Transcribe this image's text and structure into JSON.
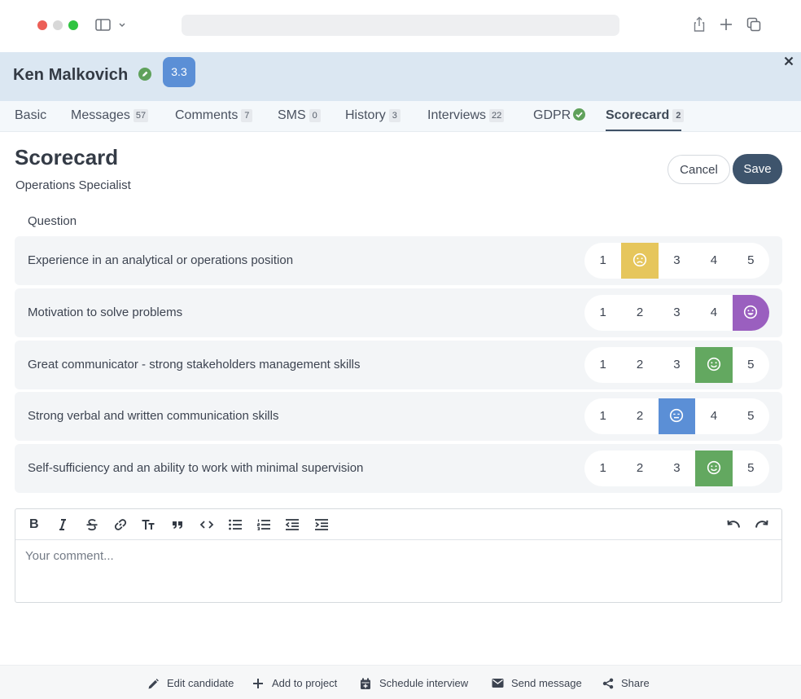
{
  "candidate": {
    "name": "Ken Malkovich",
    "rating": "3.3"
  },
  "tabs": [
    {
      "label": "Basic",
      "count": null
    },
    {
      "label": "Messages",
      "count": "57"
    },
    {
      "label": "Comments",
      "count": "7"
    },
    {
      "label": "SMS",
      "count": "0"
    },
    {
      "label": "History",
      "count": "3"
    },
    {
      "label": "Interviews",
      "count": "22"
    },
    {
      "label": "GDPR",
      "count": null
    },
    {
      "label": "Scorecard",
      "count": "2"
    }
  ],
  "active_tab": "Scorecard",
  "scorecard": {
    "title": "Scorecard",
    "subtitle": "Operations Specialist",
    "cancel_label": "Cancel",
    "save_label": "Save",
    "column_header": "Question",
    "questions": [
      {
        "text": "Experience in an analytical or operations position",
        "options": [
          "1",
          "2",
          "3",
          "4",
          "5"
        ],
        "selected": 2,
        "selected_color": "#e6c65c",
        "face": "sad-face-icon"
      },
      {
        "text": "Motivation to solve problems",
        "options": [
          "1",
          "2",
          "3",
          "4",
          "5"
        ],
        "selected": 5,
        "selected_color": "#9a5fbf",
        "face": "happy-face-icon"
      },
      {
        "text": "Great communicator - strong stakeholders management skills",
        "options": [
          "1",
          "2",
          "3",
          "4",
          "5"
        ],
        "selected": 4,
        "selected_color": "#63a860",
        "face": "smile-face-icon"
      },
      {
        "text": "Strong verbal and written communication skills",
        "options": [
          "1",
          "2",
          "3",
          "4",
          "5"
        ],
        "selected": 3,
        "selected_color": "#5b8fd6",
        "face": "neutral-face-icon"
      },
      {
        "text": "Self-sufficiency and an ability to work with minimal supervision",
        "options": [
          "1",
          "2",
          "3",
          "4",
          "5"
        ],
        "selected": 4,
        "selected_color": "#63a860",
        "face": "smile-face-icon"
      }
    ]
  },
  "editor": {
    "placeholder": "Your comment...",
    "toolbar": [
      "bold-icon",
      "italic-icon",
      "strikethrough-icon",
      "link-icon",
      "heading-icon",
      "quote-icon",
      "code-icon",
      "bullet-list-icon",
      "numbered-list-icon",
      "outdent-icon",
      "indent-icon",
      "undo-icon",
      "redo-icon"
    ]
  },
  "footer": {
    "edit_candidate": "Edit candidate",
    "add_to_project": "Add to project",
    "schedule_interview": "Schedule interview",
    "send_message": "Send message",
    "share": "Share"
  },
  "colors": {
    "header_bg": "#dbe7f2",
    "tabs_bg": "#f4f8fb",
    "save_bg": "#3e546c",
    "rating_bg": "#5b8fd6",
    "verified_green": "#5fa15b"
  }
}
